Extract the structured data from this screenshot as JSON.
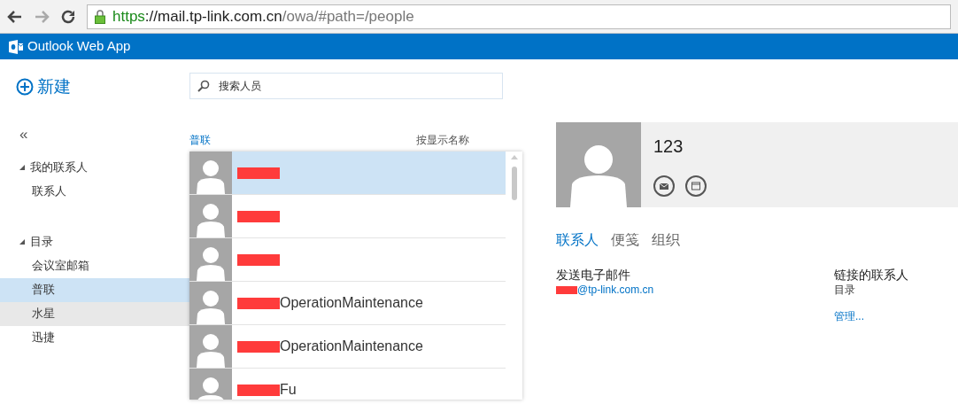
{
  "browser": {
    "url_scheme": "https",
    "url_host": "://mail.tp-link.com.cn",
    "url_path": "/owa/#path=/people"
  },
  "app_bar": {
    "title": "Outlook Web App"
  },
  "new_button": {
    "label": "新建"
  },
  "search": {
    "placeholder": "搜索人员"
  },
  "sidebar": {
    "collapse": "«",
    "groups": [
      {
        "label": "我的联系人",
        "expanded": true,
        "children": [
          {
            "label": "联系人",
            "selected": false,
            "hovered": false
          }
        ]
      },
      {
        "label": "目录",
        "expanded": true,
        "children": [
          {
            "label": "会议室邮箱",
            "selected": false,
            "hovered": false
          },
          {
            "label": "普联",
            "selected": true,
            "hovered": false
          },
          {
            "label": "水星",
            "selected": false,
            "hovered": true
          },
          {
            "label": "迅捷",
            "selected": false,
            "hovered": false
          }
        ]
      }
    ]
  },
  "list": {
    "title": "普联",
    "sort": "按显示名称",
    "rows": [
      {
        "name": "",
        "redacted": true,
        "selected": true
      },
      {
        "name": "",
        "redacted": true,
        "selected": false
      },
      {
        "name": "",
        "redacted": true,
        "selected": false
      },
      {
        "name": "OperationMaintenance",
        "redacted": true,
        "selected": false
      },
      {
        "name": "OperationMaintenance",
        "redacted": true,
        "selected": false
      },
      {
        "name": "Fu",
        "redacted": true,
        "selected": false
      }
    ]
  },
  "detail": {
    "name": "123",
    "tabs": [
      {
        "label": "联系人",
        "selected": true
      },
      {
        "label": "便笺",
        "selected": false
      },
      {
        "label": "组织",
        "selected": false
      }
    ],
    "email_heading": "发送电子邮件",
    "email": "@tp-link.com.cn",
    "email_redacted": true,
    "linked_heading": "链接的联系人",
    "linked_source": "目录",
    "manage_link": "管理..."
  }
}
